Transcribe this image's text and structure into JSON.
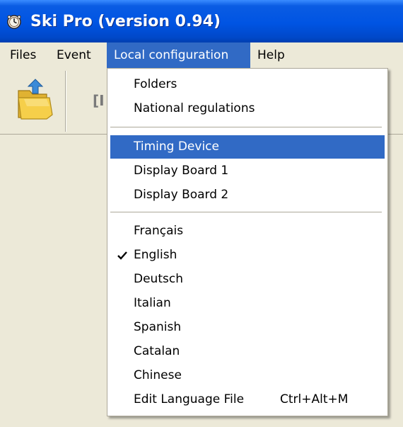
{
  "window": {
    "title": "Ski Pro (version 0.94)",
    "app_icon": "gear-clock-icon"
  },
  "menubar": {
    "items": [
      {
        "label": "Files"
      },
      {
        "label": "Event"
      },
      {
        "label": "Local configuration"
      },
      {
        "label": "Help"
      }
    ],
    "active": "Local configuration"
  },
  "toolbar": {
    "open_icon": "folder-open-icon",
    "partial_text": "[I"
  },
  "dropdown": {
    "group1": [
      "Folders",
      "National regulations"
    ],
    "group2": [
      "Timing Device",
      "Display Board 1",
      "Display Board 2"
    ],
    "selected": "Timing Device",
    "group3": [
      "Français",
      "English",
      "Deutsch",
      "Italian",
      "Spanish",
      "Catalan",
      "Chinese",
      "Edit Language File"
    ],
    "checked": "English",
    "check_icon": "checkmark-icon",
    "edit_language_shortcut": "Ctrl+Alt+M"
  },
  "colors": {
    "titlebar": "#0054e3",
    "menu_highlight": "#316ac5",
    "face": "#ece9d8"
  }
}
